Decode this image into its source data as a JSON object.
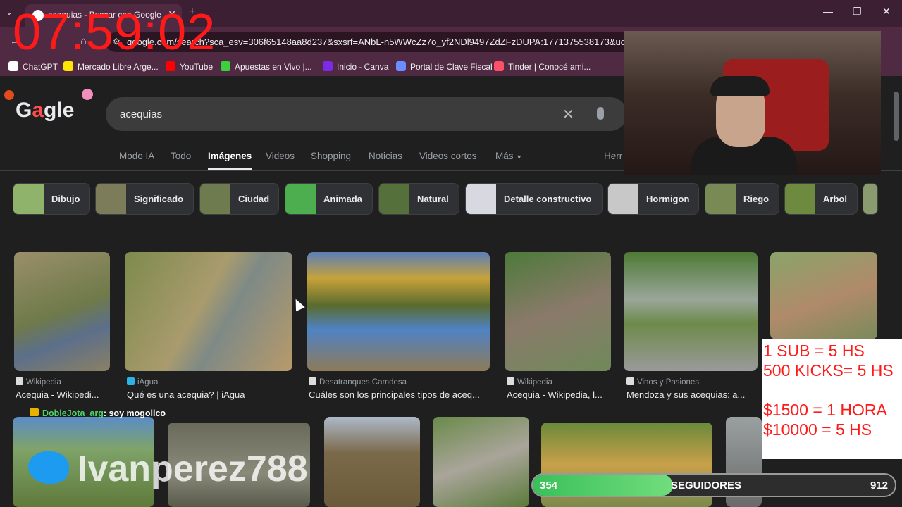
{
  "browser": {
    "tab_title": "acequias - Buscar con Google",
    "url": "google.com/search?sca_esv=306f65148aa8d237&sxsrf=ANbL-n5WWcZz7o_yf2NDl9497ZdZFzDUPA:1771375538173&udm",
    "bookmarks": [
      {
        "label": "ChatGPT",
        "color": "#ffffff"
      },
      {
        "label": "Mercado Libre Arge...",
        "color": "#ffe600"
      },
      {
        "label": "YouTube",
        "color": "#ff0000"
      },
      {
        "label": "Apuestas en Vivo |...",
        "color": "#3ad13a"
      },
      {
        "label": "Inicio - Canva",
        "color": "#7d2ae8"
      },
      {
        "label": "Portal de Clave Fiscal",
        "color": "#6c8cff"
      },
      {
        "label": "Tinder | Conocé ami...",
        "color": "#fd5068"
      }
    ]
  },
  "google": {
    "logo": "Gaagle",
    "query": "acequias",
    "nav": [
      "Modo IA",
      "Todo",
      "Imágenes",
      "Videos",
      "Shopping",
      "Noticias",
      "Videos cortos",
      "Más",
      "Herr"
    ],
    "active_nav": "Imágenes",
    "chips": [
      "Dibujo",
      "Significado",
      "Ciudad",
      "Animada",
      "Natural",
      "Detalle constructivo",
      "Hormigon",
      "Riego",
      "Arbol"
    ],
    "results": [
      {
        "source": "Wikipedia",
        "caption": "Acequia - Wikipedi..."
      },
      {
        "source": "iAgua",
        "caption": "Qué es una acequia? | iAgua"
      },
      {
        "source": "Desatranques Camdesa",
        "caption": "Cuáles son los principales tipos de aceq..."
      },
      {
        "source": "Wikipedia",
        "caption": "Acequia - Wikipedia, l..."
      },
      {
        "source": "Vinos y Pasiones",
        "caption": "Mendoza y sus acequias: a..."
      }
    ]
  },
  "overlay": {
    "timer": "07:59:02",
    "promo_lines": [
      "1 SUB = 5 HS",
      "500 KICKS= 5 HS",
      "",
      "$1500 = 1 HORA",
      "$10000 = 5 HS"
    ],
    "chat_user": "DobleJota_arg",
    "chat_message": ": soy mogolico",
    "twitter_handle": "Ivanperez788",
    "goal": {
      "current": "354",
      "label": "SEGUIDORES",
      "target": "912",
      "fraction": 0.388
    }
  }
}
